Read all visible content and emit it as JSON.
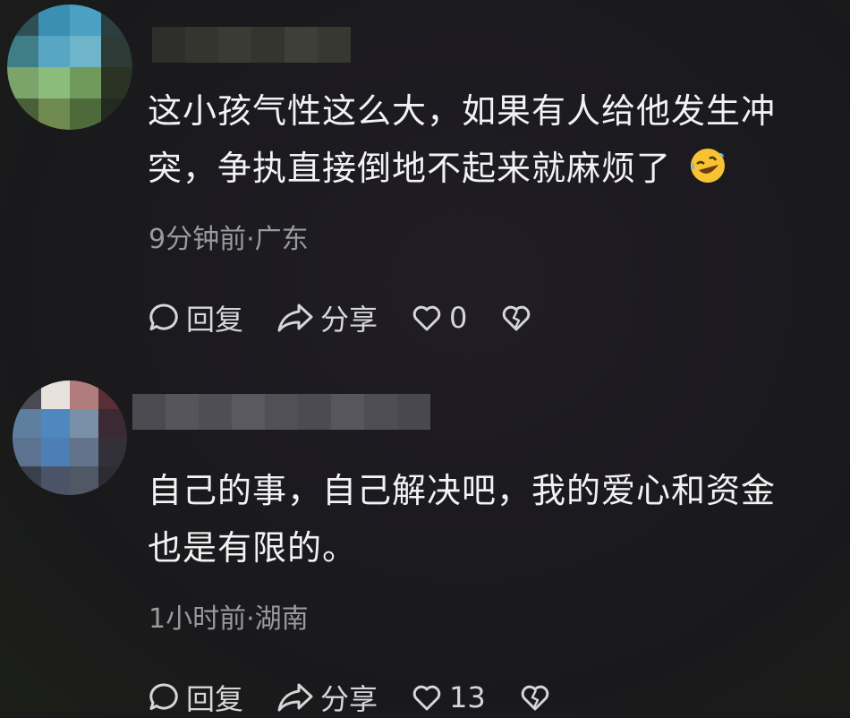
{
  "comments": [
    {
      "text": "这小孩气性这么大，如果有人给他发生冲突，争执直接倒地不起来就麻烦了",
      "emoji": "rolling-on-floor-laughing-emoji",
      "meta": "9分钟前·广东",
      "reply_label": "回复",
      "share_label": "分享",
      "like_count": "0"
    },
    {
      "text": "自己的事，自己解决吧，我的爱心和资金也是有限的。",
      "meta": "1小时前·湖南",
      "reply_label": "回复",
      "share_label": "分享",
      "like_count": "13"
    }
  ],
  "colors": {
    "background": "#1b1a1f",
    "text": "#f2f2f3",
    "meta": "#9a9a9c",
    "action": "#d6d6d8"
  },
  "icons": [
    "comment-icon",
    "share-icon",
    "heart-icon",
    "broken-heart-icon"
  ]
}
